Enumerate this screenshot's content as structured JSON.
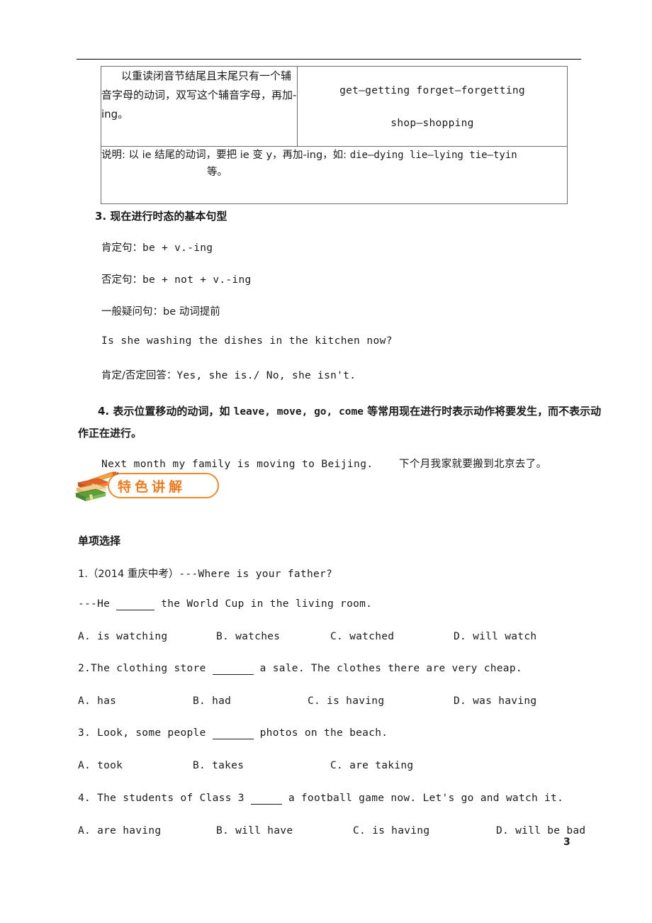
{
  "document": {
    "page_number": "3"
  },
  "table": {
    "row1": {
      "rule": "以重读闭音节结尾且末尾只有一个辅音字母的动词，双写这个辅音字母，再加-ing。",
      "examples_line1": "get—getting  forget—forgetting",
      "examples_line2": "shop—shopping"
    },
    "row2": {
      "note_prefix": "说明:",
      "note_zh1": "以 ie 结尾的动词，要把 ie 变 y，再加-ing，如:",
      "note_examples": "die—dying  lie—lying  tie—tyin",
      "note_line2": "等。"
    }
  },
  "section3": {
    "heading": "3. 现在进行时态的基本句型",
    "lines": [
      {
        "zh": "肯定句：",
        "en": "be + v.-ing"
      },
      {
        "zh": "否定句：",
        "en": "be + not + v.-ing"
      },
      {
        "zh": "一般疑问句：",
        "en": "be 动词提前"
      }
    ],
    "example_question": "Is she washing the dishes in the kitchen now?",
    "answer_label": "肯定/否定回答：",
    "answer_text": "Yes, she is./ No, she isn't."
  },
  "section4": {
    "paragraph_part1": "4. 表示位置移动的动词，如",
    "paragraph_verbs": "leave, move, go, come",
    "paragraph_part2": "等常用现在进行时表示动作将要发生，而不表示动作正在进行。",
    "example_en": "Next month my family is moving to Beijing.",
    "example_zh": "下个月我家就要搬到北京去了。"
  },
  "banner": {
    "label": "特色讲解",
    "accent_color": "#F07B1E",
    "book_top_color": "#E2622A",
    "book_mid_color": "#F2A33C",
    "book_bottom_color": "#5E9E3E",
    "icon": "books-pencil-icon"
  },
  "exercises": {
    "heading": "单项选择",
    "questions": [
      {
        "number": "1",
        "stem_line1_pre": "1.（2014 重庆中考）",
        "stem_line1_en": "---Where is your father?",
        "stem_line2_pre": "---He ",
        "stem_line2_post": " the World Cup in the living room.",
        "options": [
          "A. is watching",
          "B. watches",
          "C. watched",
          "D. will watch"
        ]
      },
      {
        "number": "2",
        "stem_pre": "2.The clothing store ",
        "stem_post": " a sale. The clothes there are very cheap.",
        "options": [
          "A. has",
          "B. had",
          "C. is having",
          "D. was having"
        ]
      },
      {
        "number": "3",
        "stem_pre": "3. Look, some people ",
        "stem_post": " photos on the beach.",
        "options": [
          "A. took",
          "B. takes",
          "C. are taking"
        ]
      },
      {
        "number": "4",
        "stem_pre": "4. The students of Class 3 ",
        "stem_post": " a football game now. Let's go and watch it.",
        "options": [
          "A. are having",
          "B. will have",
          "C. is having",
          "D. will be bad"
        ]
      }
    ]
  }
}
